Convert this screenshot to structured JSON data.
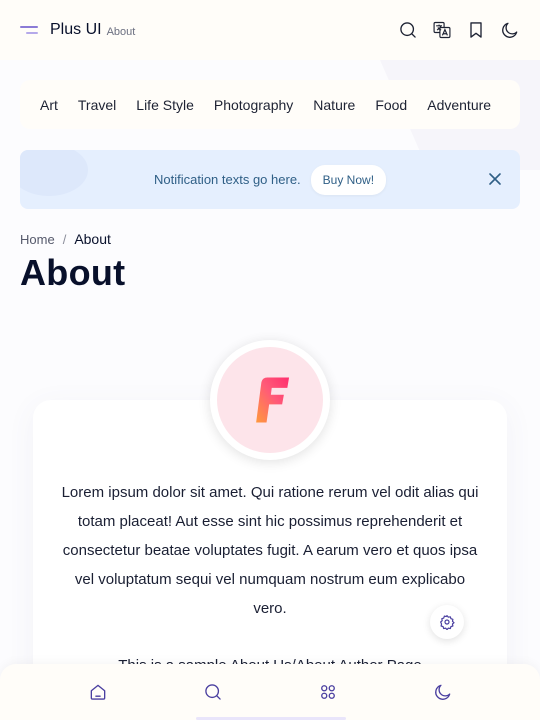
{
  "header": {
    "title": "Plus UI",
    "subtitle": "About",
    "icons": [
      "menu-icon",
      "search-icon",
      "translate-icon",
      "bookmark-icon",
      "moon-icon"
    ]
  },
  "categories": [
    "Art",
    "Travel",
    "Life Style",
    "Photography",
    "Nature",
    "Food",
    "Adventure"
  ],
  "notification": {
    "text": "Notification texts go here.",
    "button_label": "Buy Now!"
  },
  "breadcrumb": {
    "home": "Home",
    "separator": "/",
    "current": "About"
  },
  "page_title": "About",
  "card": {
    "paragraph": "Lorem ipsum dolor sit amet. Qui ratione rerum vel odit alias qui totam placeat! Aut esse sint hic possimus reprehenderit et consectetur beatae voluptates fugit. A earum vero et quos ipsa vel voluptatum sequi vel numquam nostrum eum explicabo vero.",
    "paragraph2": "This is a sample About Us/About Author Page",
    "logo_letter": "F"
  },
  "bottom_nav": {
    "icons": [
      "home-icon",
      "search-icon",
      "apps-icon",
      "moon-icon"
    ]
  },
  "colors": {
    "accent": "#8b7bd6",
    "notice_bg": "#e5effe",
    "notice_text": "#2f5f86",
    "logo_gradient_start": "#ff4f7a",
    "logo_gradient_end": "#ff9a3c",
    "avatar_bg": "#fde4ea"
  }
}
